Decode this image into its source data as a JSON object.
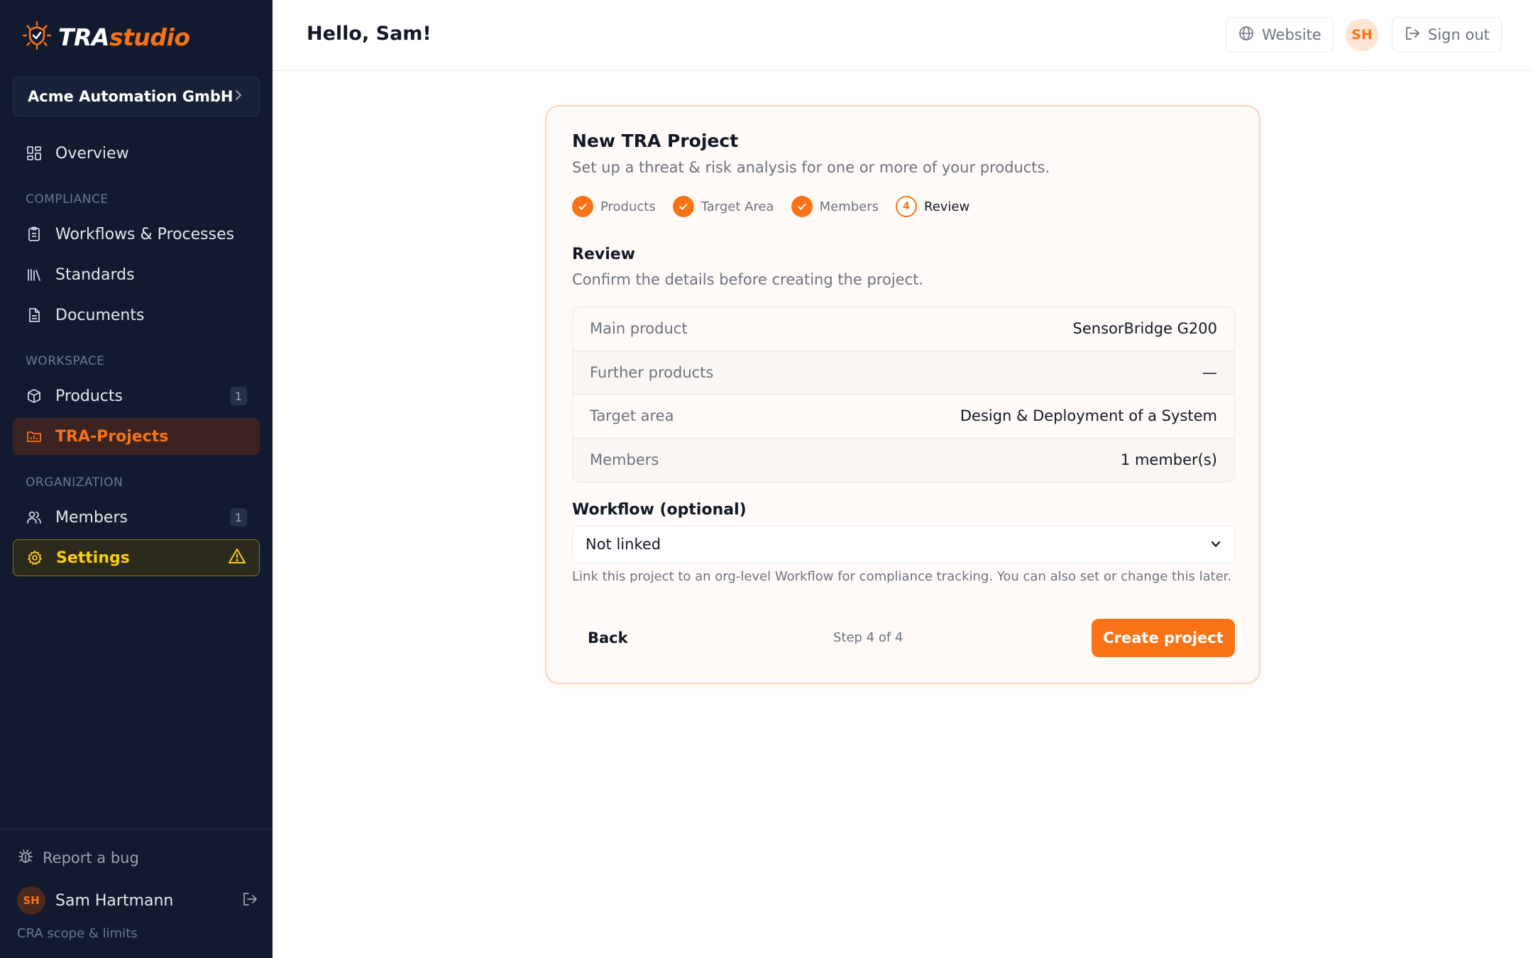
{
  "brand": {
    "part1": "TRA",
    "part2": "studio",
    "accent": "#f97316"
  },
  "org": {
    "name": "Acme Automation GmbH"
  },
  "sidebar": {
    "overview": "Overview",
    "sections": {
      "compliance": "COMPLIANCE",
      "workspace": "WORKSPACE",
      "organization": "ORGANIZATION"
    },
    "workflows": "Workflows & Processes",
    "standards": "Standards",
    "documents": "Documents",
    "products": {
      "label": "Products",
      "count": "1"
    },
    "tra_projects": "TRA-Projects",
    "members": {
      "label": "Members",
      "count": "1"
    },
    "settings": "Settings",
    "report_bug": "Report a bug",
    "user": {
      "initials": "SH",
      "name": "Sam Hartmann"
    },
    "cra_link": "CRA scope & limits"
  },
  "header": {
    "greeting": "Hello, Sam!",
    "website": "Website",
    "avatar_initials": "SH",
    "sign_out": "Sign out"
  },
  "wizard": {
    "title": "New TRA Project",
    "subtitle": "Set up a threat & risk analysis for one or more of your products.",
    "steps": [
      {
        "label": "Products",
        "state": "done"
      },
      {
        "label": "Target Area",
        "state": "done"
      },
      {
        "label": "Members",
        "state": "done"
      },
      {
        "label": "Review",
        "state": "current",
        "number": "4"
      }
    ],
    "review_title": "Review",
    "review_subtitle": "Confirm the details before creating the project.",
    "summary": [
      {
        "key": "Main product",
        "value": "SensorBridge G200"
      },
      {
        "key": "Further products",
        "value": "—"
      },
      {
        "key": "Target area",
        "value": "Design & Deployment of a System"
      },
      {
        "key": "Members",
        "value": "1 member(s)"
      }
    ],
    "workflow_label": "Workflow (optional)",
    "workflow_value": "Not linked",
    "workflow_help": "Link this project to an org-level Workflow for compliance tracking. You can also set or change this later.",
    "back": "Back",
    "step_count": "Step 4 of 4",
    "create": "Create project"
  }
}
